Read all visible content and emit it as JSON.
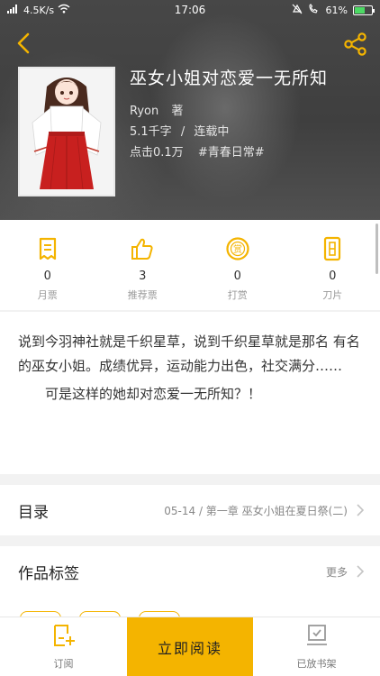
{
  "colors": {
    "accent": "#f4b400",
    "header_bg": "#474747",
    "text_dark": "#333333",
    "text_muted": "#9a9a9a"
  },
  "status_bar": {
    "network": "4.5K/s",
    "time": "17:06",
    "battery": "61%",
    "battery_level": 0.61
  },
  "header": {
    "back_icon": "back-arrow-icon",
    "share_icon": "share-icon",
    "title": "巫女小姐对恋爱一无所知",
    "author": "Ryon",
    "author_suffix": "著",
    "words": "5.1千字",
    "status": "连载中",
    "clicks": "点击0.1万",
    "tag": "#青春日常#"
  },
  "stats": [
    {
      "icon": "monthly-ticket-icon",
      "value": "0",
      "label": "月票"
    },
    {
      "icon": "thumbs-up-icon",
      "value": "3",
      "label": "推荐票"
    },
    {
      "icon": "reward-icon",
      "value": "0",
      "label": "打赏"
    },
    {
      "icon": "blade-icon",
      "value": "0",
      "label": "刀片"
    }
  ],
  "synopsis": {
    "para1": "说到今羽神社就是千织星草，说到千织星草就是那名 有名的巫女小姐。成绩优异，运动能力出色，社交满分……",
    "para2": "可是这样的她却对恋爱一无所知？！"
  },
  "catalog": {
    "title": "目录",
    "latest": "05-14 / 第一章 巫女小姐在夏日祭(二)"
  },
  "work_tags": {
    "title": "作品标签",
    "more": "更多"
  },
  "bottom_bar": {
    "subscribe": "订阅",
    "read_now": "立即阅读",
    "shelf": "已放书架"
  }
}
